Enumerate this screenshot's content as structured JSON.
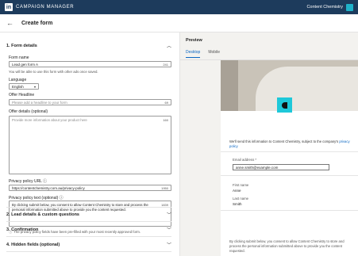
{
  "app": {
    "title": "CAMPAIGN MANAGER",
    "account": "Content Chemistry",
    "logo": "in"
  },
  "header": {
    "back": "←",
    "title": "Create form"
  },
  "form": {
    "section1": {
      "title": "1.  Form details",
      "chevron": "up"
    },
    "form_name": {
      "label": "Form name",
      "value": "Lead gen form A",
      "count": "241",
      "help": "You will be able to use this form with other ads once saved."
    },
    "language": {
      "label": "Language",
      "value": "English"
    },
    "offer_headline": {
      "label": "Offer Headline",
      "placeholder": "Please add a headline to your form",
      "count": "69"
    },
    "offer_details": {
      "label": "Offer details (optional)",
      "placeholder": "Provide more information about your product here",
      "count": "160"
    },
    "privacy_url": {
      "label": "Privacy policy URL",
      "value": "https://contentchemistry.com.au/privacy-policy",
      "count": "1950"
    },
    "privacy_text": {
      "label": "Privacy policy text (optional)",
      "value": "By clicking submit below, you consent to allow Content Chemistry to store and process the personal information submitted above to provide you the content requested.",
      "count": "1839"
    },
    "prefill_note": "The privacy policy fields have been pre-filled with your most recently approved form.",
    "sections": [
      {
        "title": "2.  Lead details & custom questions"
      },
      {
        "title": "3.  Confirmation"
      },
      {
        "title": "4.  Hidden fields (optional)"
      }
    ]
  },
  "preview": {
    "title": "Preview",
    "tabs": [
      "Desktop",
      "Mobile"
    ],
    "consent_text": "We'll send this information to Content Chemistry, subject to the company's ",
    "consent_link": "privacy policy",
    "email_label": "Email address *",
    "email_value": "anne.smith@example.com",
    "first_name_label": "First name",
    "first_name_value": "Anne",
    "last_name_label": "Last name",
    "last_name_value": "Smith",
    "footer_text": "By clicking submit below, you consent to allow Content Chemistry to store and process the personal information submitted above to provide you the content requested."
  },
  "colors": {
    "topbar": "#1d3b5c",
    "accent": "#0a66c2",
    "brand": "#1ec8d9"
  }
}
